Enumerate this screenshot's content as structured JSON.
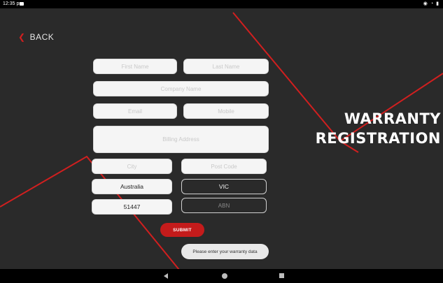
{
  "status_bar": {
    "time": "12:35 pm"
  },
  "back": {
    "label": "BACK"
  },
  "form": {
    "first_name": {
      "placeholder": "First Name"
    },
    "last_name": {
      "placeholder": "Last Name"
    },
    "company_name": {
      "placeholder": "Company Name"
    },
    "email": {
      "placeholder": "Email"
    },
    "mobile": {
      "placeholder": "Mobile"
    },
    "billing_address": {
      "placeholder": "Billing Address"
    },
    "city": {
      "placeholder": "City"
    },
    "post_code": {
      "placeholder": "Post Code"
    },
    "country": {
      "value": "Australia"
    },
    "state": {
      "value": "VIC"
    },
    "serial": {
      "value": "51447"
    },
    "abn": {
      "placeholder": "ABN"
    },
    "submit_label": "SUBMIT"
  },
  "heading": {
    "line1": "WARRANTY",
    "line2": "REGISTRATION"
  },
  "toast": {
    "message": "Please enter your warranty data"
  },
  "colors": {
    "accent": "#c41b1b",
    "background": "#2a2a2a"
  }
}
